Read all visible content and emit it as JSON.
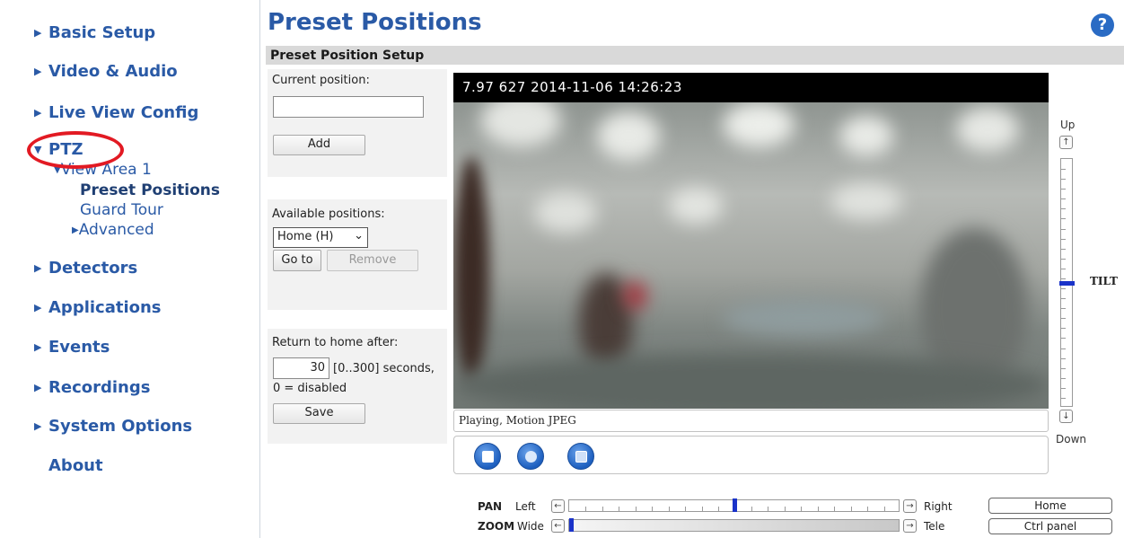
{
  "sidebar": {
    "items": [
      {
        "label": "Basic Setup"
      },
      {
        "label": "Video & Audio"
      },
      {
        "label": "Live View Config"
      },
      {
        "label": "PTZ"
      },
      {
        "label": "Detectors"
      },
      {
        "label": "Applications"
      },
      {
        "label": "Events"
      },
      {
        "label": "Recordings"
      },
      {
        "label": "System Options"
      },
      {
        "label": "About"
      }
    ],
    "ptz_sub": {
      "view_area": "View Area 1",
      "preset_positions": "Preset Positions",
      "guard_tour": "Guard Tour",
      "advanced": "Advanced"
    },
    "colors": {
      "link": "#2a5aa6",
      "highlight_oval": "#e21a23"
    }
  },
  "header": {
    "title": "Preset Positions",
    "help_icon": "help-question-icon"
  },
  "section": {
    "title": "Preset Position Setup"
  },
  "current_position": {
    "label": "Current position:",
    "value": "",
    "add_button": "Add"
  },
  "available_positions": {
    "label": "Available positions:",
    "selected": "Home (H)",
    "goto_button": "Go to",
    "remove_button": "Remove"
  },
  "return_home": {
    "label": "Return to home after:",
    "value": "30",
    "range_text": "[0..300] seconds,",
    "note": "0 = disabled",
    "save_button": "Save"
  },
  "video": {
    "overlay_text": "7.97   627 2014-11-06 14:26:23",
    "status": "Playing, Motion JPEG",
    "controls": [
      "stop-icon",
      "snapshot-camera-icon",
      "fullscreen-icon"
    ]
  },
  "tilt": {
    "up_label": "Up",
    "down_label": "Down",
    "label": "TILT",
    "position": 0.5
  },
  "pan": {
    "label": "PAN",
    "left": "Left",
    "right": "Right",
    "position": 0.5
  },
  "zoom": {
    "label": "ZOOM",
    "wide": "Wide",
    "tele": "Tele",
    "position": 0.0
  },
  "right_buttons": {
    "home": "Home",
    "ctrl_panel": "Ctrl panel"
  }
}
